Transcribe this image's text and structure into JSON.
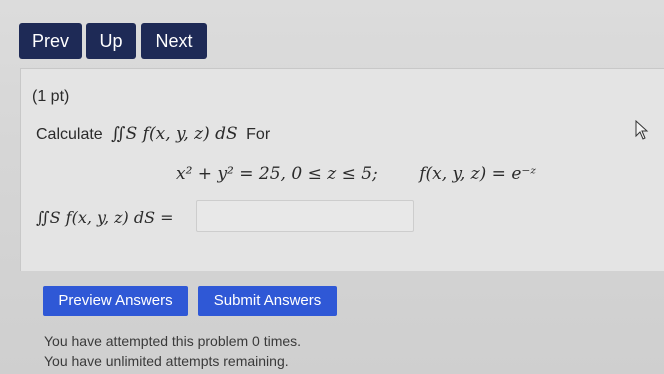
{
  "nav": {
    "prev": "Prev",
    "up": "Up",
    "next": "Next"
  },
  "problem": {
    "points": "(1 pt)",
    "calculate": "Calculate",
    "integral": "∬S f(x, y, z) dS",
    "for": "For",
    "surface": "x² + y² = 25,   0 ≤ z ≤ 5;",
    "function": "f(x, y, z) = e⁻ᶻ"
  },
  "answer": {
    "label": "∬S f(x, y, z) dS =",
    "value": ""
  },
  "actions": {
    "preview": "Preview Answers",
    "submit": "Submit Answers"
  },
  "status": {
    "attempted": "You have attempted this problem 0 times.",
    "remaining": "You have unlimited attempts remaining."
  },
  "colors": {
    "nav_bg": "#1e2a56",
    "action_bg": "#2f58d6"
  },
  "icons": {
    "cursor": "mouse-pointer-icon"
  }
}
